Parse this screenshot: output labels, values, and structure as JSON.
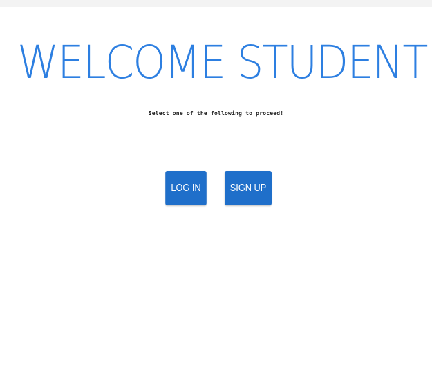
{
  "heading": "WELCOME STUDENT",
  "subheading": "Select one of the following to proceed!",
  "buttons": {
    "login_label": "LOG IN",
    "signup_label": "SIGN UP"
  },
  "colors": {
    "heading": "#2d7fe1",
    "button_bg": "#1f6fca",
    "button_text": "#ffffff"
  }
}
